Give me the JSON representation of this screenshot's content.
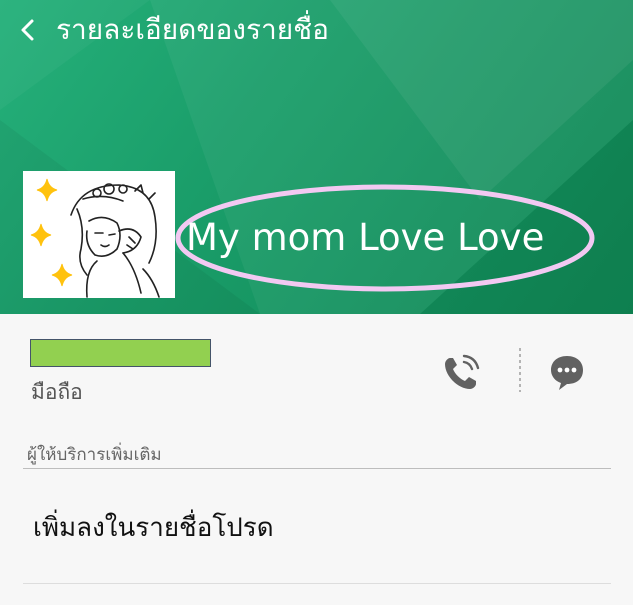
{
  "header": {
    "title": "รายละเอียดของรายชื่อ",
    "back_icon": "chevron-left-icon",
    "background_color": "#1a9d69"
  },
  "contact": {
    "name": "My mom Love Love",
    "annotation_color": "#f2c9f2"
  },
  "phone": {
    "redaction_color": "#92d050",
    "type_label": "มือถือ",
    "call_icon": "phone-icon",
    "message_icon": "message-icon"
  },
  "services": {
    "section_label": "ผู้ให้บริการเพิ่มเติม",
    "add_to_favorites_label": "เพิ่มลงในรายชื่อโปรด"
  }
}
